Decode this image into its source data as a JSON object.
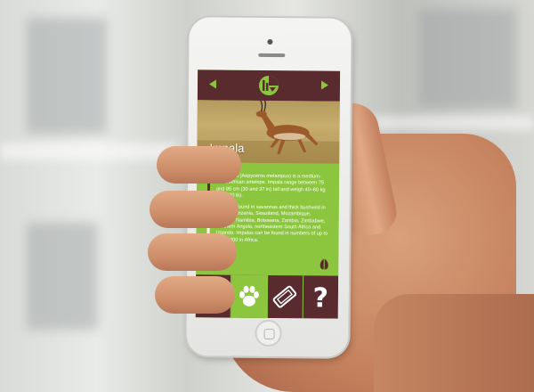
{
  "app": {
    "animal_name": "Impala",
    "description_p1": "An impala (Aepyceros melampus) is a medium-sized African antelope. Impala range between 75 and 95 cm (30 and 37 in) tall and weigh 40–60 kg (88–130 lb).",
    "description_p2": "They are found in savannas and thick bushveld in Kenya, Tanzania, Swaziland, Mozambique, northern Namibia, Botswana, Zambia, Zimbabwe, southern Angola, northeastern South Africa and Uganda. Impalas can be found in numbers of up to 2,000,000 in Africa.",
    "tabs": [
      {
        "icon": "globe-icon",
        "active": false
      },
      {
        "icon": "paw-icon",
        "active": true
      },
      {
        "icon": "ticket-icon",
        "active": false
      },
      {
        "icon": "help-icon",
        "label": "?",
        "active": false
      }
    ],
    "colors": {
      "header": "#5a2b2e",
      "accent": "#8cc63f",
      "text": "#ffffff"
    }
  }
}
